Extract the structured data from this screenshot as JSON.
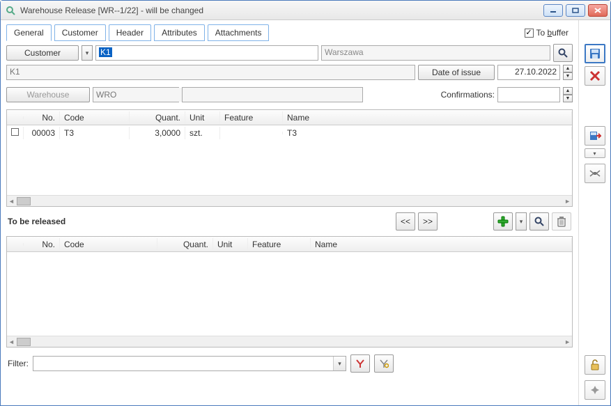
{
  "window": {
    "title": "Warehouse Release [WR--1/22]  - will be changed"
  },
  "tabs": {
    "general": "General",
    "customer": "Customer",
    "header": "Header",
    "attributes": "Attributes",
    "attachments": "Attachments"
  },
  "to_buffer_label": "To buffer",
  "customer_btn": "Customer",
  "customer_code_value": "K1",
  "customer_city_value": "Warszawa",
  "customer_name_value": "K1",
  "date_of_issue_btn": "Date of issue",
  "date_value": "27.10.2022",
  "warehouse_btn": "Warehouse",
  "warehouse_value": "WRO",
  "confirmations_label": "Confirmations:",
  "grid1": {
    "headers": {
      "no": "No.",
      "code": "Code",
      "quant": "Quant.",
      "unit": "Unit",
      "feature": "Feature",
      "name": "Name"
    },
    "rows": [
      {
        "no": "00003",
        "code": "T3",
        "quant": "3,0000",
        "unit": "szt.",
        "feature": "",
        "name": "T3"
      }
    ]
  },
  "tbr_title": "To be released",
  "nav_prev": "<<",
  "nav_next": ">>",
  "grid2": {
    "headers": {
      "no": "No.",
      "code": "Code",
      "quant": "Quant.",
      "unit": "Unit",
      "feature": "Feature",
      "name": "Name"
    }
  },
  "filter_label": "Filter:"
}
